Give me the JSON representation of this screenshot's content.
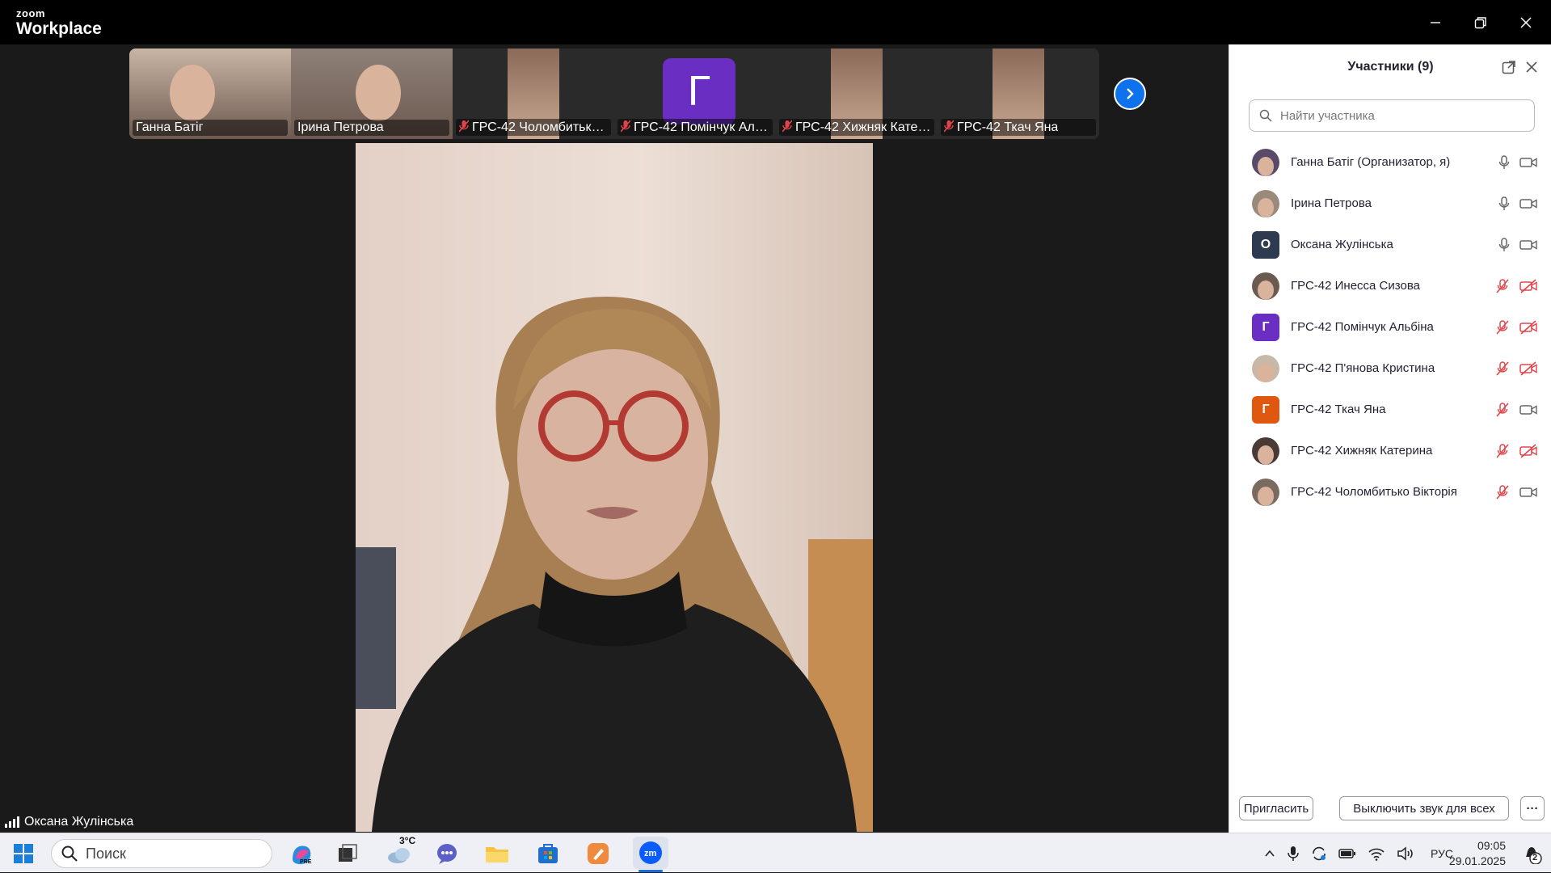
{
  "app": {
    "brand_small": "zoom",
    "brand_large": "Workplace"
  },
  "window_controls": [
    "minimize-icon",
    "restore-icon",
    "close-icon"
  ],
  "gallery": {
    "thumbnails": [
      {
        "name": "Ганна Батіг",
        "muted": false,
        "bg": "#c9b5a4"
      },
      {
        "name": "Ірина Петрова",
        "muted": false,
        "bg": "#8e8078"
      },
      {
        "name": "ГРС-42 Чоломбитько ...",
        "muted": true,
        "bg": "#2a2a2a"
      },
      {
        "name": "ГРС-42 Помінчук Аль...",
        "muted": true,
        "bg": "#2a2a2a",
        "initial": "Г",
        "initial_color": "#6a2fc2"
      },
      {
        "name": "ГРС-42 Хижняк Катер...",
        "muted": true,
        "bg": "#2a2a2a"
      },
      {
        "name": "ГРС-42 Ткач Яна",
        "muted": true,
        "bg": "#2a2a2a"
      }
    ],
    "next_icon": "chevron-right-icon"
  },
  "active_speaker": {
    "name": "Оксана Жулінська"
  },
  "participants_panel": {
    "title": "Участники (9)",
    "search_placeholder": "Найти участника",
    "participants": [
      {
        "name": "Ганна Батіг (Организатор, я)",
        "avatar": "photo",
        "avatar_color": "#5a4a6a",
        "mic_muted": false,
        "video_off": false
      },
      {
        "name": "Ірина Петрова",
        "avatar": "photo",
        "avatar_color": "#9a8a7a",
        "mic_muted": false,
        "video_off": false
      },
      {
        "name": "Оксана Жулінська",
        "avatar": "О",
        "avatar_color": "#2d3a4f",
        "mic_muted": false,
        "video_off": false
      },
      {
        "name": "ГРС-42 Инесса Сизова",
        "avatar": "photo",
        "avatar_color": "#6a5a50",
        "mic_muted": true,
        "video_off": true
      },
      {
        "name": "ГРС-42 Помінчук Альбіна",
        "avatar": "Г",
        "avatar_color": "#6a2fc2",
        "mic_muted": true,
        "video_off": true
      },
      {
        "name": "ГРС-42 П'янова Кристина",
        "avatar": "photo",
        "avatar_color": "#c8b8a8",
        "mic_muted": true,
        "video_off": true
      },
      {
        "name": "ГРС-42 Ткач Яна",
        "avatar": "Г",
        "avatar_color": "#e0580f",
        "mic_muted": true,
        "video_off": false
      },
      {
        "name": "ГРС-42 Хижняк Катерина",
        "avatar": "photo",
        "avatar_color": "#4a3a35",
        "mic_muted": true,
        "video_off": true
      },
      {
        "name": "ГРС-42 Чоломбитько Вікторія",
        "avatar": "photo",
        "avatar_color": "#7a6a60",
        "mic_muted": true,
        "video_off": false
      }
    ],
    "invite_label": "Пригласить",
    "mute_all_label": "Выключить звук для всех",
    "more_label": "···"
  },
  "taskbar": {
    "search_placeholder": "Поиск",
    "weather_temp": "3°C",
    "language": "РУС",
    "time": "09:05",
    "date": "29.01.2025",
    "notification_count": "2"
  }
}
